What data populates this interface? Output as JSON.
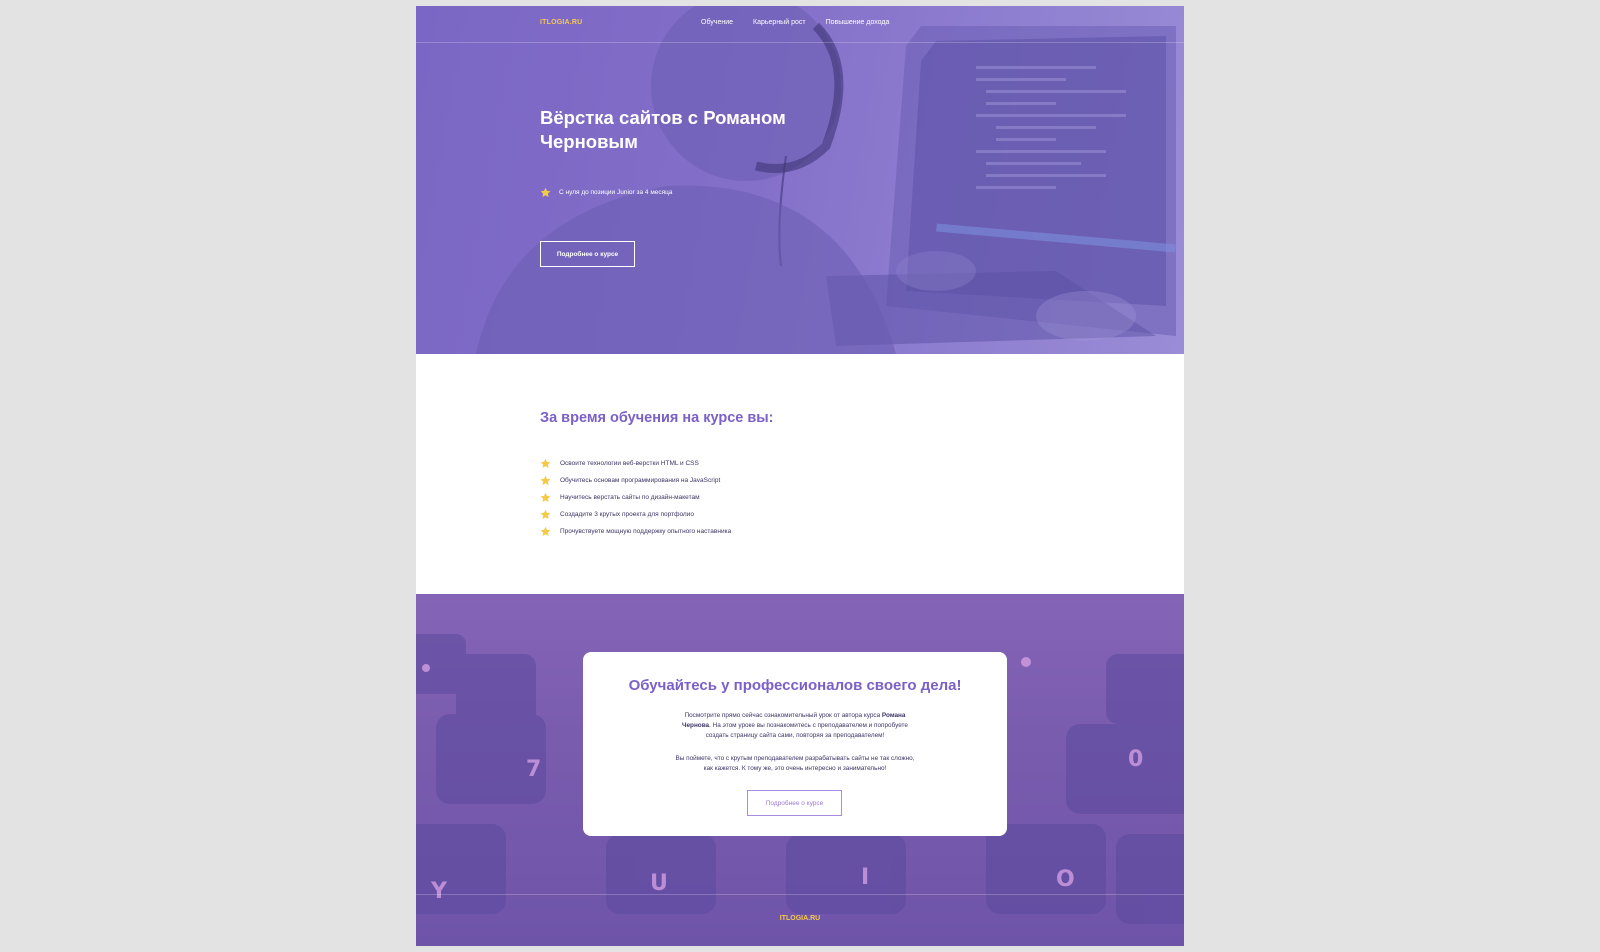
{
  "header": {
    "logo": "ITLOGIA.RU",
    "nav": [
      "Обучение",
      "Карьерный рост",
      "Повышение дохода"
    ]
  },
  "hero": {
    "title": "Вёрстка сайтов с Романом Черновым",
    "point": "С нуля до позиции Junior за 4 месяца",
    "button": "Подробнее о курсе"
  },
  "benefits": {
    "title": "За время обучения на курсе вы:",
    "items": [
      "Освоите технологии веб-верстки HTML и CSS",
      "Обучитесь основам программирования на JavaScript",
      "Научитесь верстать сайты по дизайн-макетам",
      "Создадите 3 крутых проекта для портфолио",
      "Прочувствуете мощную поддержку опытного наставника"
    ]
  },
  "promo": {
    "title": "Обучайтесь у профессионалов своего дела!",
    "p1_before": "Посмотрите прямо сейчас ознакомительный урок от автора курса ",
    "p1_name": "Романа Чернова",
    "p1_after": ". На этом уроке вы познакомитесь с преподавателем и попробуете создать страницу сайта сами, повторяя за преподавателем!",
    "p2": "Вы поймете, что с крутым преподавателем разрабатывать сайты не так сложно, как кажется. К тому же, это очень интересно и занимательно!",
    "button": "Подробнее о курсе"
  },
  "footer": {
    "logo": "ITLOGIA.RU"
  },
  "colors": {
    "accent": "#7b60c8",
    "logo": "#f7c948",
    "star": "#f7c948",
    "hero_overlay": "#8470c9"
  }
}
